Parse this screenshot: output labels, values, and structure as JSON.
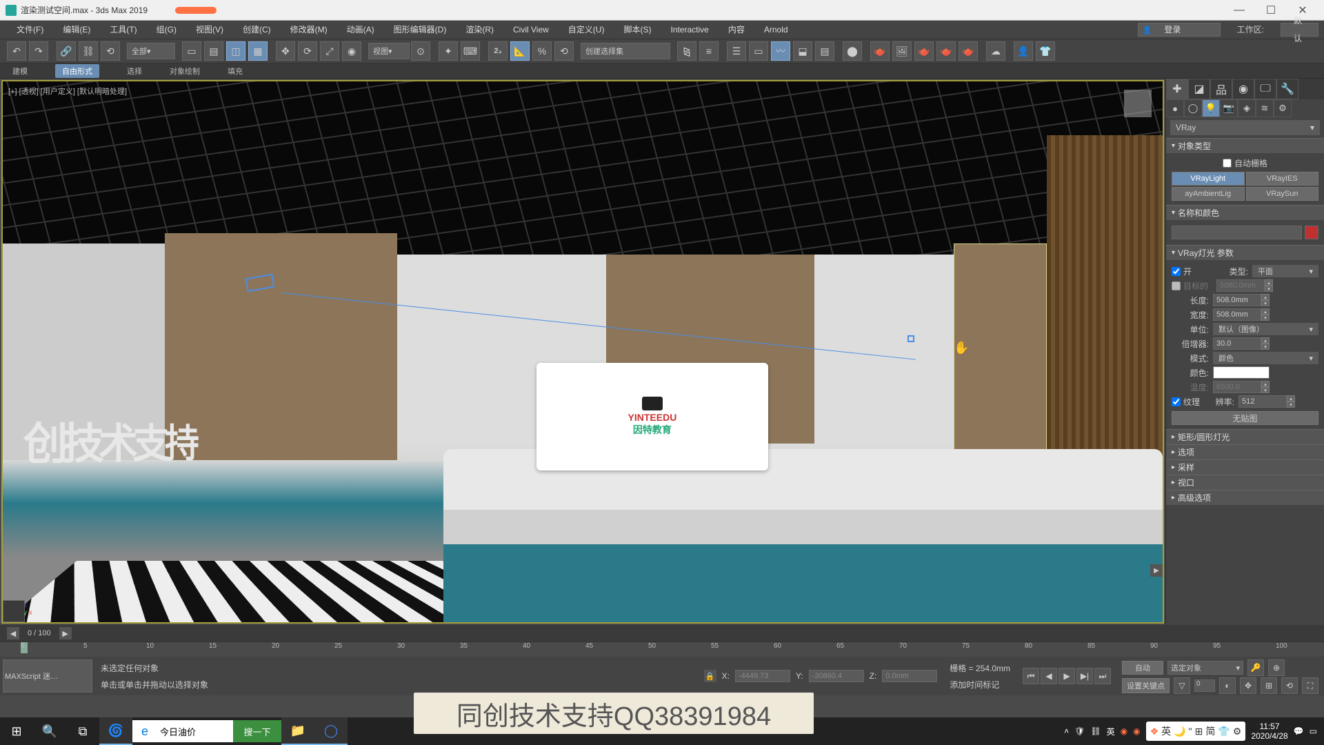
{
  "title": "渲染测试空间.max - 3ds Max 2019",
  "menu": [
    "文件(F)",
    "编辑(E)",
    "工具(T)",
    "组(G)",
    "视图(V)",
    "创建(C)",
    "修改器(M)",
    "动画(A)",
    "图形编辑器(D)",
    "渲染(R)",
    "Civil View",
    "自定义(U)",
    "脚本(S)",
    "Interactive",
    "内容",
    "Arnold"
  ],
  "login": "登录",
  "workspace_label": "工作区:",
  "workspace_value": "默认",
  "toolbar": {
    "all": "全部",
    "view": "视图",
    "selset": "创建选择集"
  },
  "subbar": [
    "建模",
    "自由形式",
    "选择",
    "对象绘制",
    "填充"
  ],
  "viewport_label": "[+] [透视] [用户定义] [默认明暗处理]",
  "scene_text3d": "创技术支持",
  "pillow": {
    "l1": "YINTEEDU",
    "l2": "因特教育"
  },
  "cmdpanel": {
    "dropdown": "VRay",
    "roll_objtype": "对象类型",
    "autogrid": "自动栅格",
    "btns": [
      "VRayLight",
      "VRayIES",
      "ayAmbientLig",
      "VRaySun"
    ],
    "roll_namecolor": "名称和颜色",
    "roll_params": "VRay灯光 参数",
    "on": "开",
    "type_label": "类型:",
    "type_value": "平面",
    "target": "目标的",
    "target_val": "5080.0mm",
    "length": "长度:",
    "length_val": "508.0mm",
    "width": "宽度:",
    "width_val": "508.0mm",
    "unit": "单位:",
    "unit_val": "默认（图像）",
    "mult": "倍增器:",
    "mult_val": "30.0",
    "mode": "模式:",
    "mode_val": "颜色",
    "color": "颜色:",
    "temp": "温度:",
    "temp_val": "6500.0",
    "texture": "纹理",
    "res": "辨率:",
    "res_val": "512",
    "nomap": "无贴图",
    "rolls": [
      "矩形/圆形灯光",
      "选项",
      "采样",
      "视口",
      "高级选项"
    ]
  },
  "timeline": {
    "pos": "0 / 100",
    "ticks": [
      0,
      5,
      10,
      15,
      20,
      25,
      30,
      35,
      40,
      45,
      50,
      55,
      60,
      65,
      70,
      75,
      80,
      85,
      90,
      95,
      100
    ]
  },
  "status": {
    "mxs": "MAXScript 迷…",
    "msg1": "未选定任何对象",
    "msg2": "单击或单击并拖动以选择对象",
    "x_label": "X:",
    "x_val": "-4449.73",
    "y_label": "Y:",
    "y_val": "-30860.4",
    "z_label": "Z:",
    "z_val": "0.0mm",
    "grid": "栅格 = 254.0mm",
    "addtime": "添加时间标记",
    "auto": "自动",
    "selobj": "选定对象",
    "setkey": "设置关键点"
  },
  "overlay": "同创技术支持QQ38391984",
  "taskbar": {
    "search_value": "今日油价",
    "search_btn": "搜一下",
    "ime": [
      "英",
      "简"
    ],
    "time": "11:57",
    "date": "2020/4/28"
  }
}
